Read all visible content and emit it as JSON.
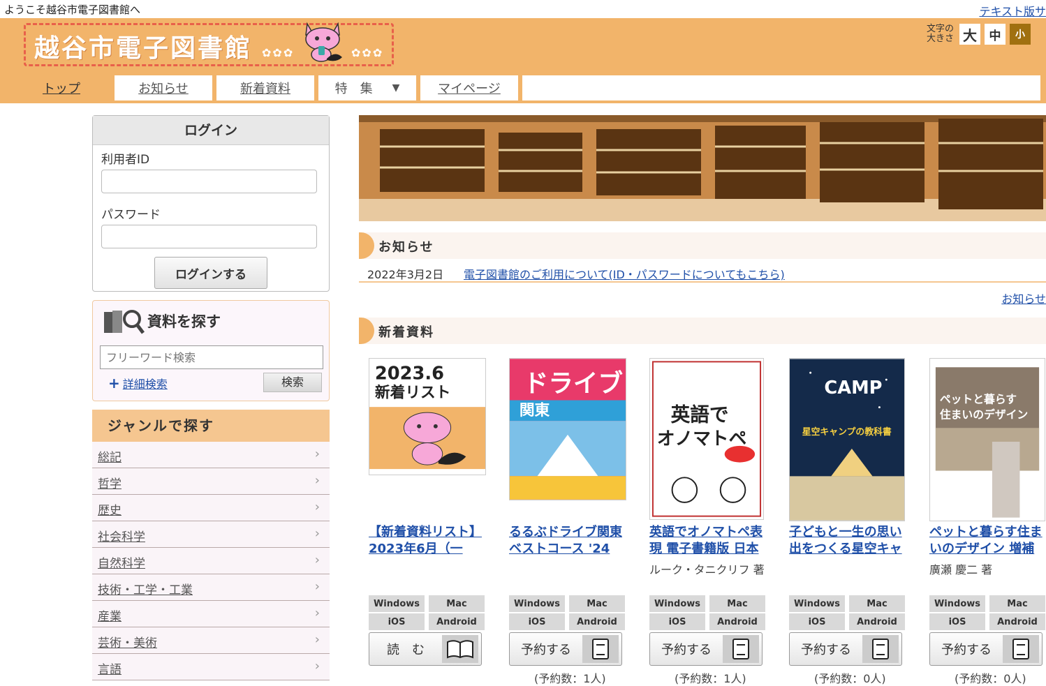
{
  "topbar": {
    "welcome": "ようこそ越谷市電子図書館へ",
    "text_version": "テキスト版サ"
  },
  "header": {
    "site_title": "越谷市電子図書館",
    "fontsize_label_1": "文字の",
    "fontsize_label_2": "大きさ",
    "fontsize_large": "大",
    "fontsize_medium": "中",
    "fontsize_small": "小"
  },
  "nav": {
    "tabs": [
      {
        "label": "トップ"
      },
      {
        "label": "お知らせ"
      },
      {
        "label": "新着資料"
      },
      {
        "label": "特　集"
      },
      {
        "label": "マイページ"
      }
    ]
  },
  "login": {
    "title": "ログイン",
    "user_id_label": "利用者ID",
    "password_label": "パスワード",
    "button": "ログインする"
  },
  "search": {
    "title": "資料を探す",
    "placeholder": "フリーワード検索",
    "advanced": "詳細検索",
    "button": "検索"
  },
  "genre": {
    "title": "ジャンルで探す",
    "items": [
      "総記",
      "哲学",
      "歴史",
      "社会科学",
      "自然科学",
      "技術・工学・工業",
      "産業",
      "芸術・美術",
      "言語"
    ]
  },
  "notice": {
    "title": "お知らせ",
    "date": "2022年3月2日",
    "link": "電子図書館のご利用について(ID・パスワードについてもこちら)",
    "more": "お知らせ"
  },
  "new_materials": {
    "title": "新着資料"
  },
  "os_labels": {
    "windows": "Windows",
    "mac": "Mac",
    "ios": "iOS",
    "android": "Android"
  },
  "books": [
    {
      "cover_line1": "2023.6",
      "cover_line2": "新着リスト",
      "title_line1": "【新着資料リスト】",
      "title_line2": "2023年6月（一",
      "author": "",
      "action": "読　む",
      "reserve_count": ""
    },
    {
      "cover_line1": "ドライブ",
      "cover_line2": "関東",
      "title_line1": "るるぶドライブ関東",
      "title_line2": "ベストコース '24",
      "author": "",
      "action": "予約する",
      "reserve_count": "(予約数：1人)"
    },
    {
      "cover_line1": "英語で",
      "cover_line2": "オノマトペ",
      "title_line1": "英語でオノマトペ表",
      "title_line2": "現 電子書籍版 日本",
      "author": "ルーク・タニクリフ 著",
      "action": "予約する",
      "reserve_count": "(予約数：1人)"
    },
    {
      "cover_line1": "CAMP",
      "cover_line2": "星空キャンプの教科書",
      "title_line1": "子どもと一生の思い",
      "title_line2": "出をつくる星空キャ",
      "author": "",
      "action": "予約する",
      "reserve_count": "(予約数：0人)"
    },
    {
      "cover_line1": "ペットと暮らす",
      "cover_line2": "住まいのデザイン",
      "title_line1": "ペットと暮らす住ま",
      "title_line2": "いのデザイン 増補",
      "author": "廣瀬 慶二 著",
      "action": "予約する",
      "reserve_count": "(予約数：0人)"
    }
  ],
  "colors": {
    "accent": "#f2b46a",
    "link": "#1f4fa8"
  }
}
